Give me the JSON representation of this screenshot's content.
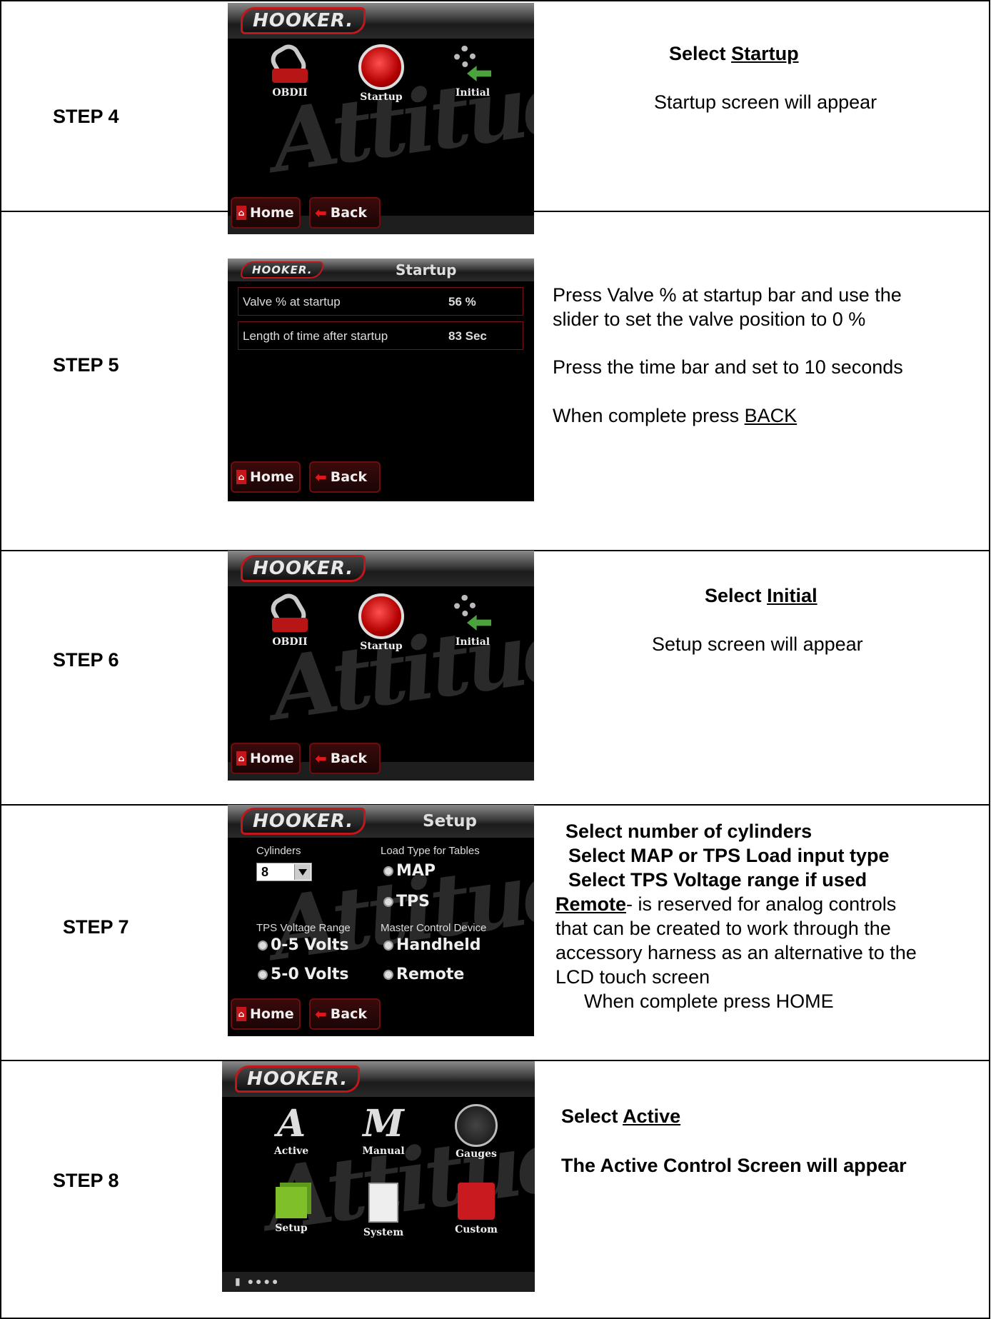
{
  "steps": [
    {
      "label": "STEP 4"
    },
    {
      "label": "STEP 5"
    },
    {
      "label": "STEP 6"
    },
    {
      "label": "STEP 7"
    },
    {
      "label": "STEP 8"
    }
  ],
  "logo": "HOOKER.",
  "common": {
    "home": "Home",
    "back": "Back"
  },
  "menu_icons": {
    "obdii": "OBDII",
    "startup": "Startup",
    "initial": "Initial"
  },
  "step4": {
    "select_prefix": "Select ",
    "select_link": "Startup",
    "note": "Startup screen will appear"
  },
  "step5": {
    "screen_title": "Startup",
    "rows": [
      {
        "label": "Valve % at startup",
        "value": "56 %"
      },
      {
        "label": "Length of time after startup",
        "value": "83 Sec"
      }
    ],
    "line1": "Press Valve % at startup bar and use the",
    "line2": "slider to set the valve position to 0 %",
    "line3": "Press the time bar and set to 10 seconds",
    "line4_prefix": "When complete press ",
    "line4_link": "BACK"
  },
  "step6": {
    "select_prefix": "Select ",
    "select_link": "Initial",
    "note": "Setup screen will appear"
  },
  "step7": {
    "screen_title": "Setup",
    "cylinders_label": "Cylinders",
    "cylinders_value": "8",
    "load_label": "Load Type for Tables",
    "map": "MAP",
    "tps": "TPS",
    "tps_range_label": "TPS Voltage Range",
    "range1": "0-5 Volts",
    "range2": "5-0 Volts",
    "master_label": "Master Control Device",
    "handheld": "Handheld",
    "remote": "Remote",
    "line1": "Select number of cylinders",
    "line2": "Select MAP or TPS Load input type",
    "line3": "Select TPS Voltage range if used",
    "remote_word": "Remote",
    "line4_rest": "- is reserved for analog controls",
    "line5": "that can be created to work through the",
    "line6": "accessory harness as an alternative to the",
    "line7": "LCD touch screen",
    "line8": "When complete press HOME"
  },
  "step8": {
    "icons": {
      "active": "Active",
      "manual": "Manual",
      "gauges": "Gauges",
      "setup": "Setup",
      "system": "System",
      "custom": "Custom"
    },
    "select_prefix": "Select ",
    "select_link": "Active",
    "note": "The Active Control Screen will appear"
  }
}
